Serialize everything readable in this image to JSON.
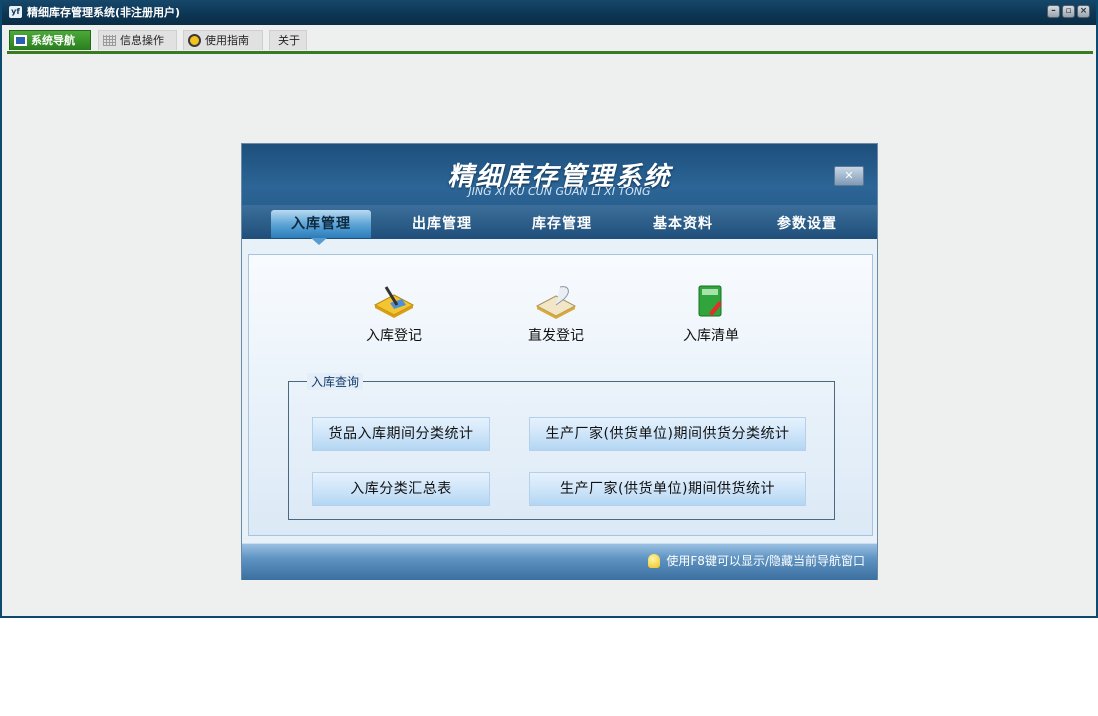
{
  "window": {
    "title": "精细库存管理系统(非注册用户)",
    "app_icon": "yf",
    "controls": [
      "minimize-icon",
      "restore-icon",
      "close-icon"
    ]
  },
  "top_tabs": [
    {
      "label": "系统导航",
      "icon": "monitor-icon",
      "active": true
    },
    {
      "label": "信息操作",
      "icon": "grid-icon",
      "active": false
    },
    {
      "label": "使用指南",
      "icon": "clock-icon",
      "active": false
    },
    {
      "label": "关于",
      "icon": "",
      "active": false
    }
  ],
  "panel": {
    "title": "精细库存管理系统",
    "subtitle": "JING XI KU CUN GUAN  LI XI TONG",
    "close_label": "✕",
    "tabs": [
      "入库管理",
      "出库管理",
      "库存管理",
      "基本资料",
      "参数设置"
    ],
    "active_tab": "入库管理",
    "features": [
      {
        "label": "入库登记",
        "icon": "pen-and-notebook-icon"
      },
      {
        "label": "直发登记",
        "icon": "book-and-quill-icon"
      },
      {
        "label": "入库清单",
        "icon": "green-notebook-icon"
      }
    ],
    "query_group": {
      "title": "入库查询",
      "buttons": [
        "货品入库期间分类统计",
        "生产厂家(供货单位)期间供货分类统计",
        "入库分类汇总表",
        "生产厂家(供货单位)期间供货统计"
      ]
    },
    "footer_hint": "使用F8键可以显示/隐藏当前导航窗口"
  },
  "colors": {
    "titlebar": "#0d3553",
    "active_tab": "#3a8d2a",
    "panel_header": "#2c6596",
    "nav_active": "#5ea5d6"
  }
}
